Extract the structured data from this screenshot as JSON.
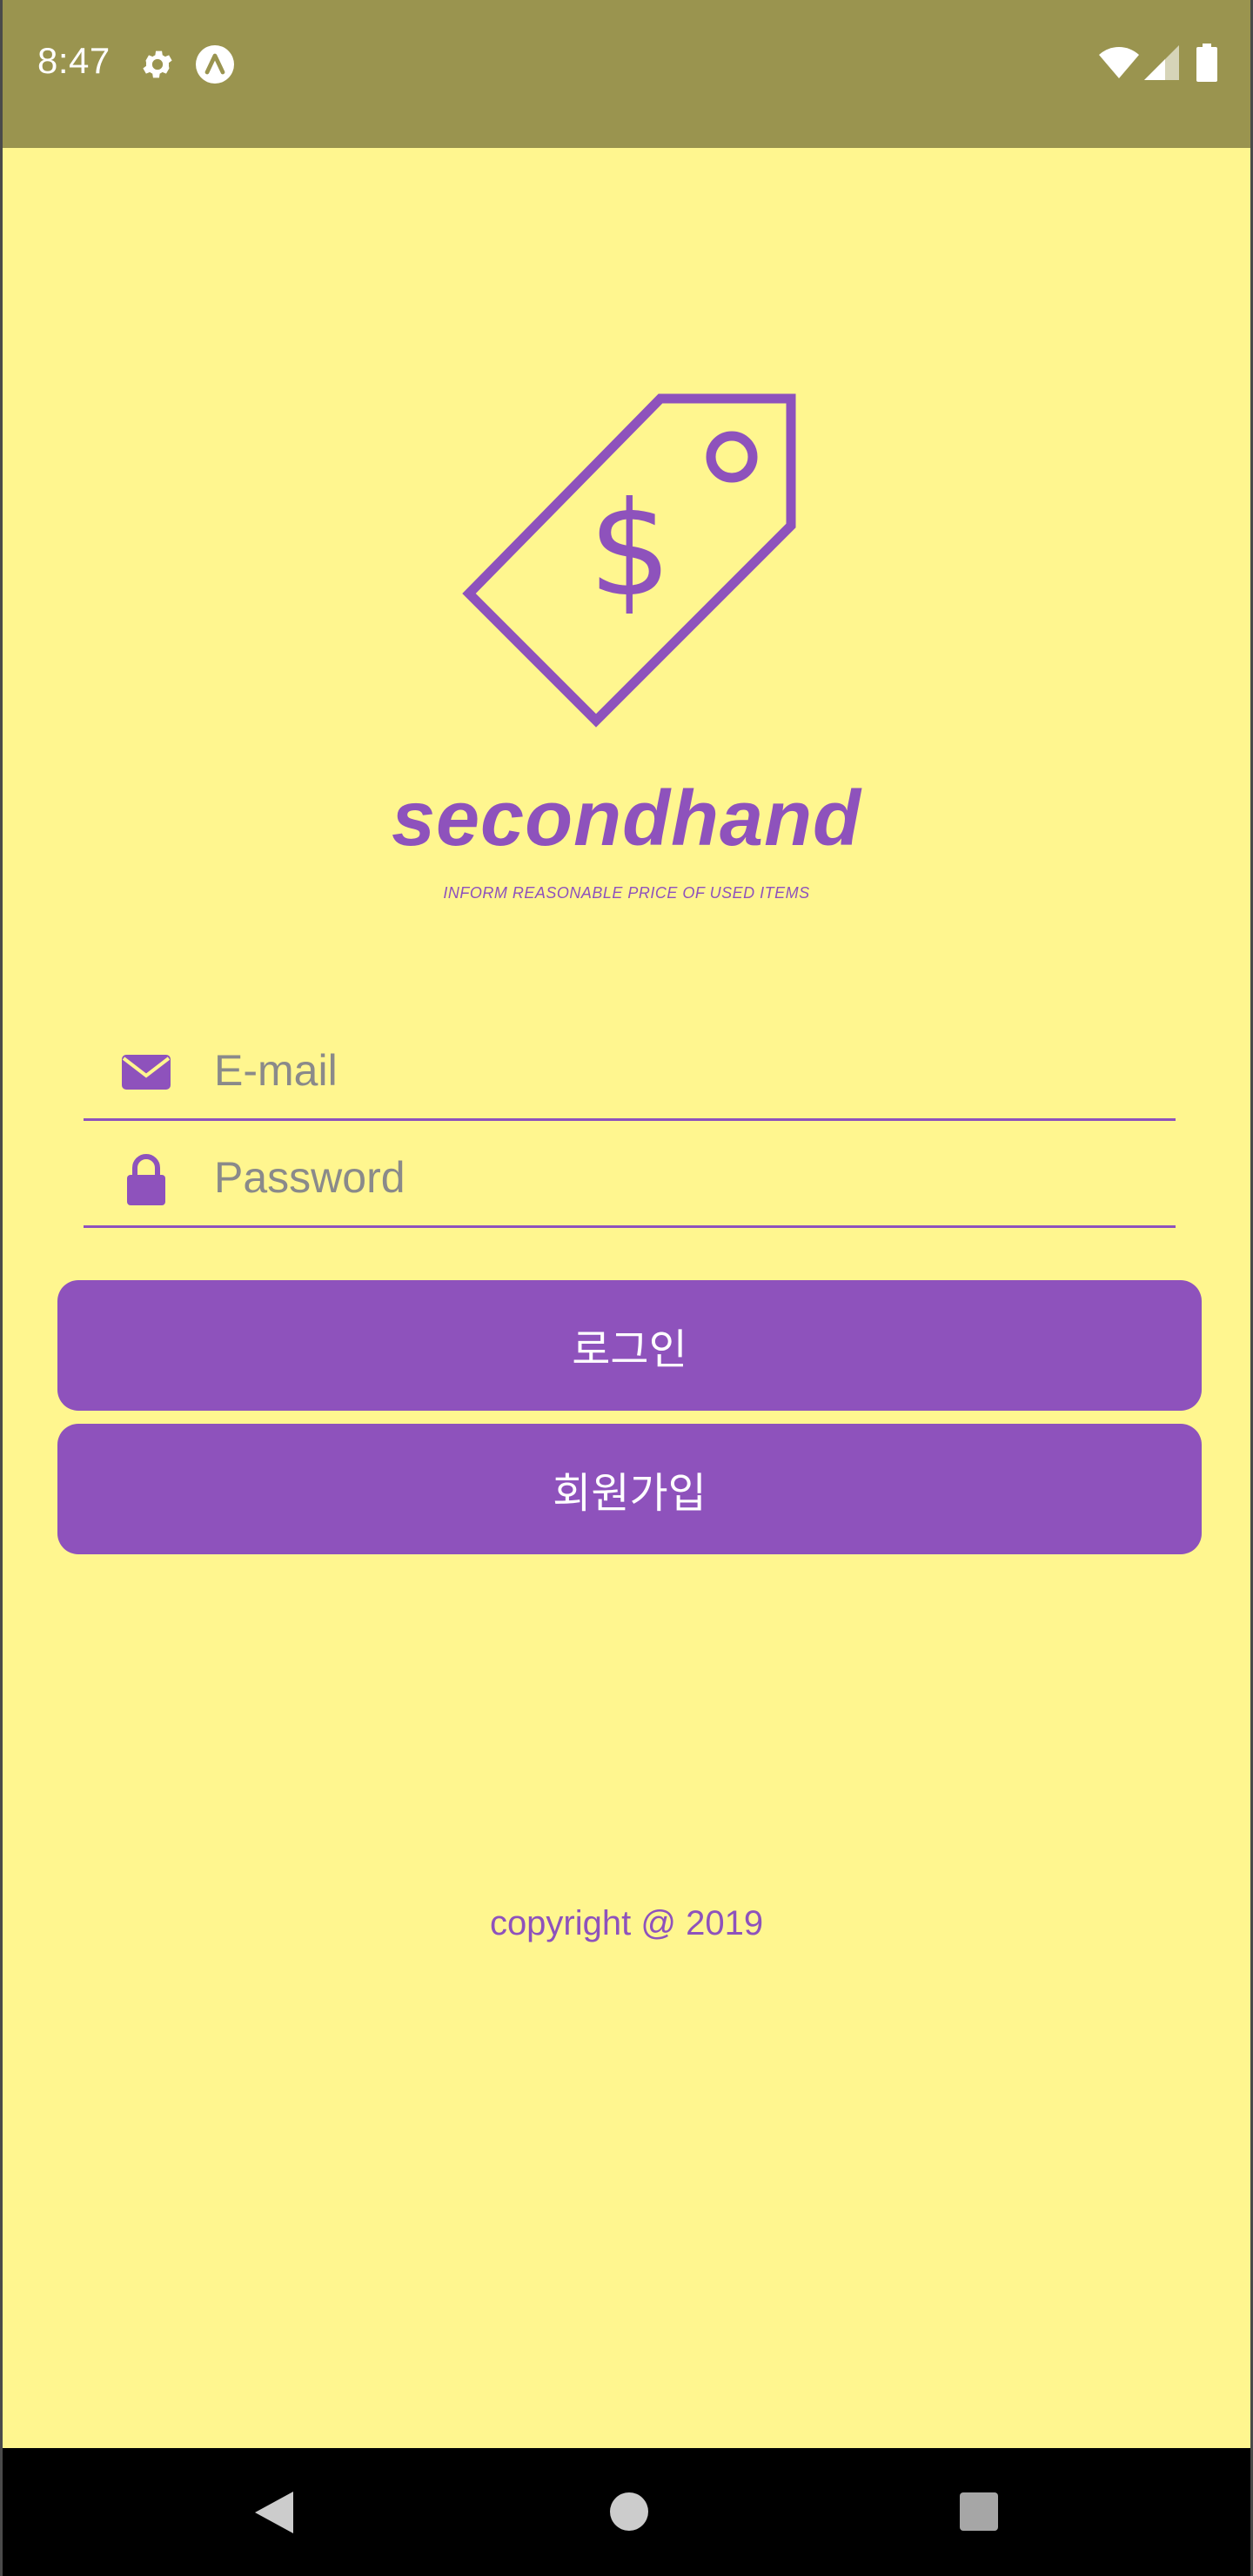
{
  "status_bar": {
    "time": "8:47",
    "icons": [
      "gear-icon",
      "app-a-icon",
      "wifi-icon",
      "signal-icon",
      "battery-icon"
    ]
  },
  "logo": {
    "icon": "price-tag-dollar-icon",
    "symbol": "$"
  },
  "app": {
    "title": "secondhand",
    "tagline": "INFORM REASONABLE PRICE OF USED ITEMS"
  },
  "form": {
    "email": {
      "icon": "envelope-icon",
      "placeholder": "E-mail",
      "value": ""
    },
    "password": {
      "icon": "lock-icon",
      "placeholder": "Password",
      "value": ""
    },
    "login_label": "로그인",
    "signup_label": "회원가입"
  },
  "footer": {
    "copyright": "copyright @ 2019"
  },
  "nav_bar": {
    "icons": [
      "back-icon",
      "home-icon",
      "recents-icon"
    ]
  },
  "colors": {
    "background": "#fff68f",
    "status_bar": "#9a944f",
    "accent": "#8e52bc",
    "nav_bar": "#000000"
  }
}
